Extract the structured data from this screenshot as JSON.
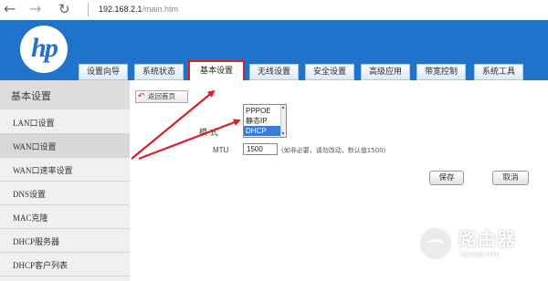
{
  "browser": {
    "back_icon": "back-arrow-icon",
    "forward_icon": "forward-arrow-icon",
    "reload_icon": "reload-icon",
    "url_host": "192.168.2.1",
    "url_path": "/main.htm"
  },
  "header": {
    "logo_text": "hp",
    "brand_color": "#1f73c9",
    "tabs": [
      {
        "label": "设置向导"
      },
      {
        "label": "系统状态"
      },
      {
        "label": "基本设置"
      },
      {
        "label": "无线设置"
      },
      {
        "label": "安全设置"
      },
      {
        "label": "高级应用"
      },
      {
        "label": "带宽控制"
      },
      {
        "label": "系统工具"
      }
    ],
    "active_tab": "基本设置"
  },
  "sidebar": {
    "title": "基本设置",
    "items": [
      {
        "label": "LAN口设置"
      },
      {
        "label": "WAN口设置"
      },
      {
        "label": "WAN口速率设置"
      },
      {
        "label": "DNS设置"
      },
      {
        "label": "MAC克隆"
      },
      {
        "label": "DHCP服务器"
      },
      {
        "label": "DHCP客户列表"
      }
    ],
    "active_item": "WAN口设置"
  },
  "content": {
    "back_button": "返回首页",
    "mode_label": "模 式",
    "mode_options": [
      "PPPOE",
      "静态IP",
      "DHCP"
    ],
    "mode_selected": "DHCP",
    "mtu_label": "MTU",
    "mtu_value": "1500",
    "mtu_hint": "(如非必要，请勿改动，默认值1500)",
    "save_label": "保存",
    "cancel_label": "取消"
  },
  "annotation": {
    "highlight_color": "#d6202a"
  },
  "watermark": {
    "title": "路由器",
    "subtitle": "luyouqi.com"
  }
}
